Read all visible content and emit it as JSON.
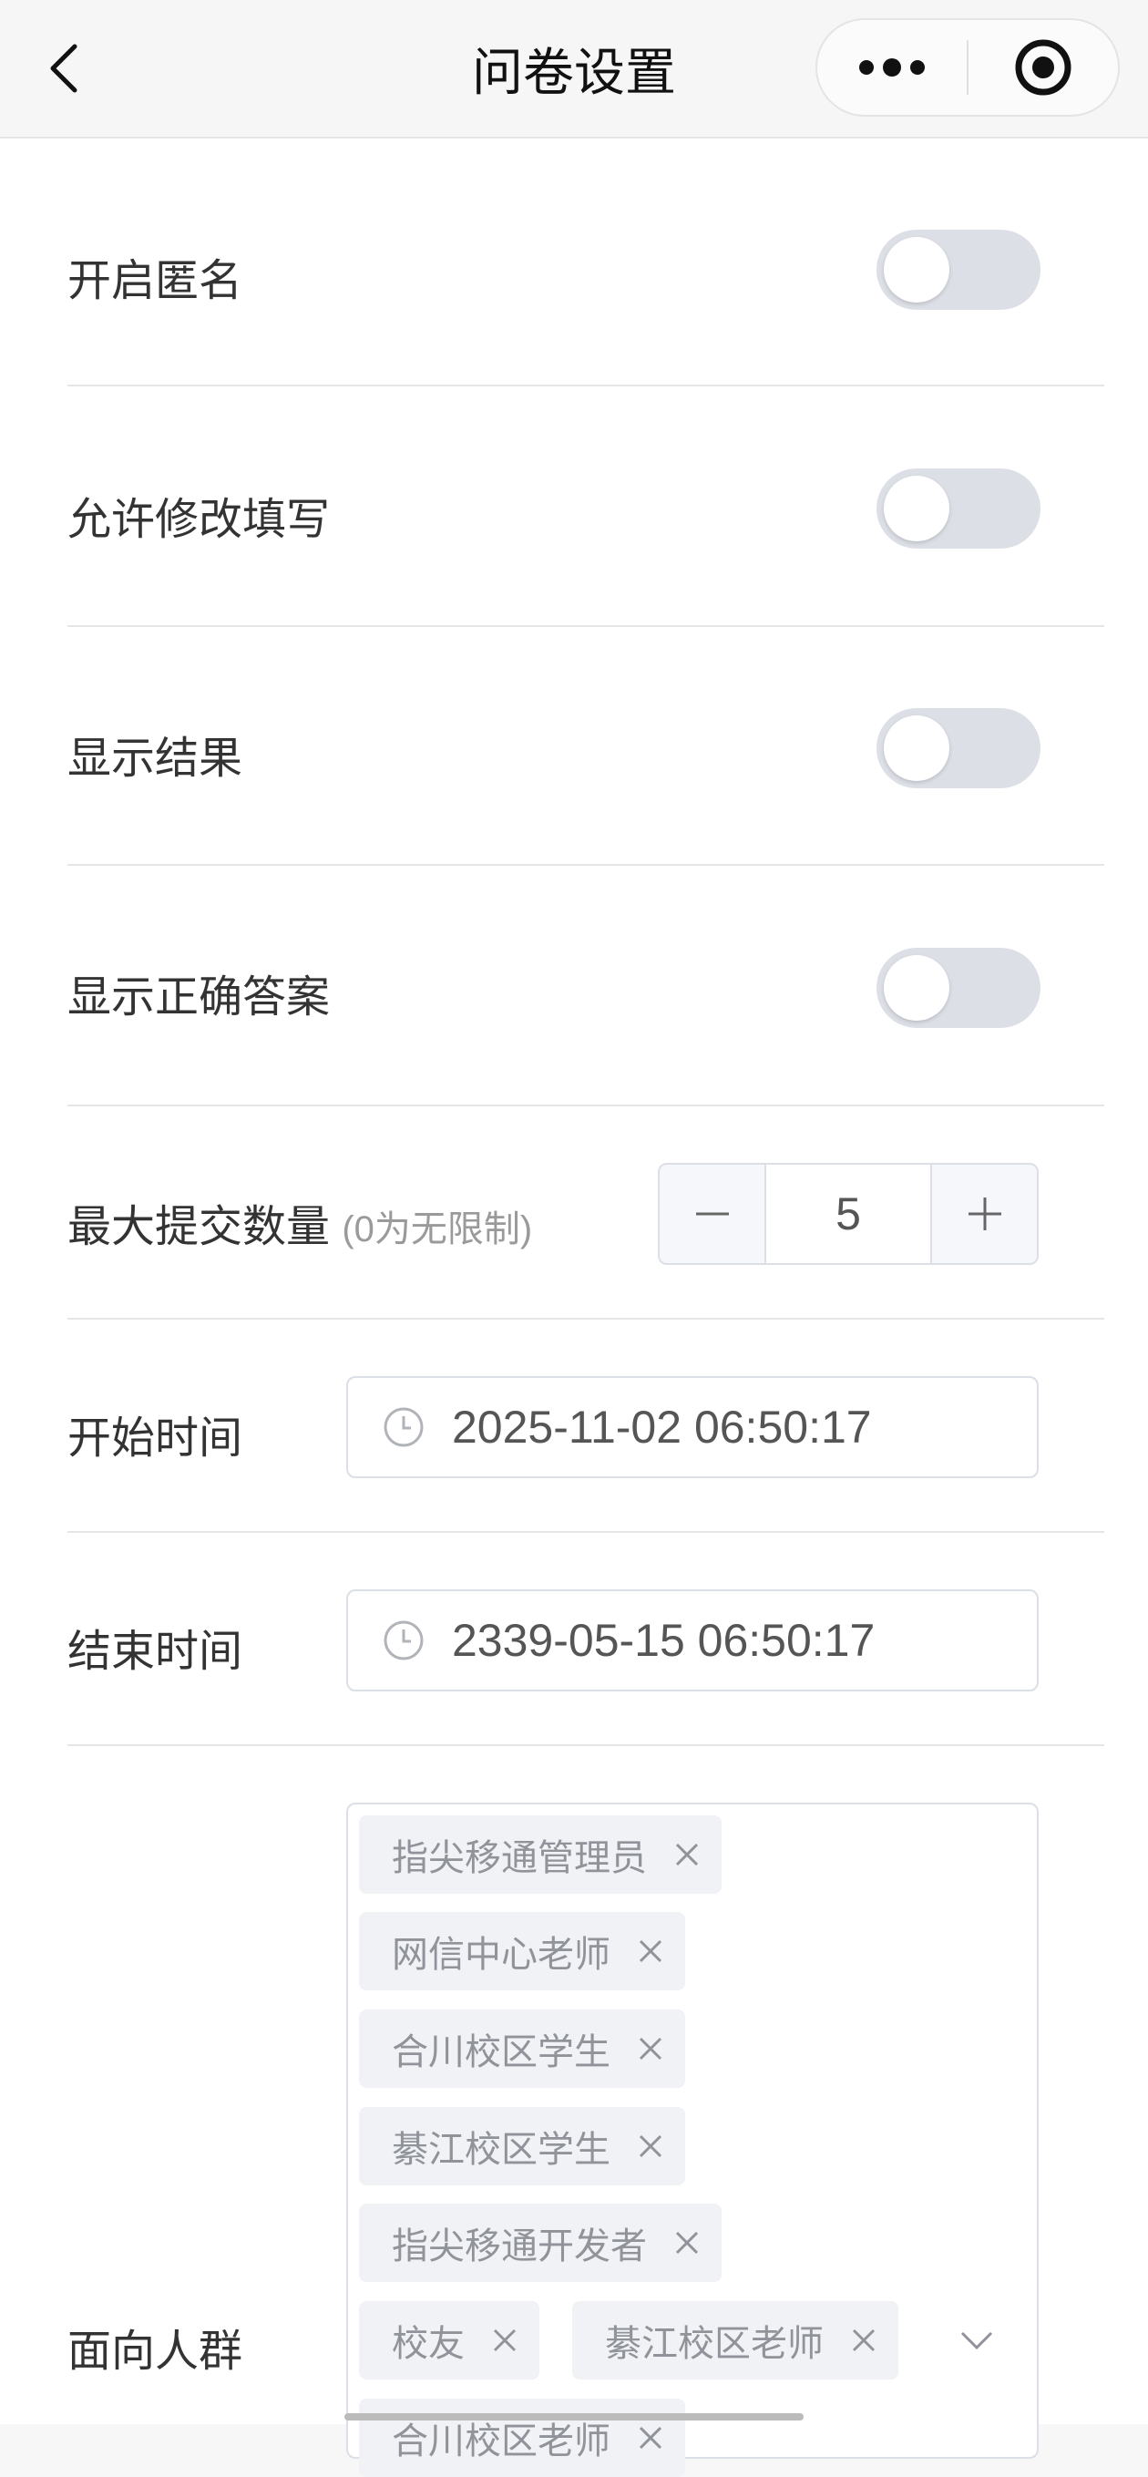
{
  "navbar": {
    "title": "问卷设置",
    "back_icon": "chevron-left-icon",
    "more_icon": "more-dots-icon",
    "close_icon": "target-circle-icon"
  },
  "settings": {
    "anonymous": {
      "label": "开启匿名",
      "enabled": false
    },
    "allow_edit": {
      "label": "允许修改填写",
      "enabled": false
    },
    "show_result": {
      "label": "显示结果",
      "enabled": false
    },
    "show_answer": {
      "label": "显示正确答案",
      "enabled": false
    }
  },
  "max_submit": {
    "label": "最大提交数量",
    "hint": "(0为无限制)",
    "value": "5"
  },
  "start_time": {
    "label": "开始时间",
    "value": "2025-11-02 06:50:17",
    "icon": "clock-icon"
  },
  "end_time": {
    "label": "结束时间",
    "value": "2339-05-15 06:50:17",
    "icon": "clock-icon"
  },
  "audience": {
    "label": "面向人群",
    "tags": [
      "指尖移通管理员",
      "网信中心老师",
      "合川校区学生",
      "綦江校区学生",
      "指尖移通开发者",
      "校友",
      "綦江校区老师",
      "合川校区老师"
    ],
    "dropdown_icon": "chevron-down-icon"
  },
  "colors": {
    "toggle_off": "#dcdfe6",
    "border": "#dcdfe6",
    "tag_bg": "#f0f2f5",
    "tag_text": "#909399"
  }
}
